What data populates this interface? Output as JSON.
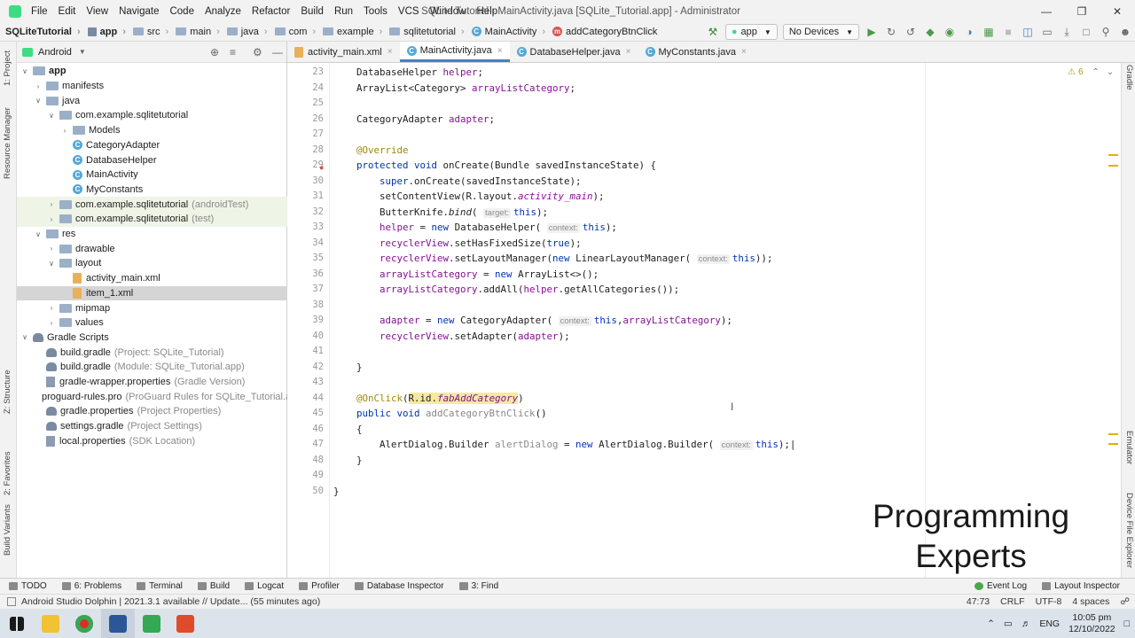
{
  "window": {
    "title": "SQLite Tutorial - MainActivity.java [SQLite_Tutorial.app] - Administrator",
    "menu": [
      "File",
      "Edit",
      "View",
      "Navigate",
      "Code",
      "Analyze",
      "Refactor",
      "Build",
      "Run",
      "Tools",
      "VCS",
      "Window",
      "Help"
    ]
  },
  "breadcrumb": [
    "SQLiteTutorial",
    "app",
    "src",
    "main",
    "java",
    "com",
    "example",
    "sqlitetutorial",
    "MainActivity",
    "addCategoryBtnClick"
  ],
  "toolbar": {
    "run_config": "app",
    "device": "No Devices"
  },
  "left_strip": [
    "1: Project",
    "Resource Manager",
    "Z: Structure",
    "2: Favorites",
    "Build Variants"
  ],
  "right_strip": [
    "Gradle",
    "Emulator",
    "Device File Explorer"
  ],
  "project": {
    "view": "Android",
    "tree": [
      {
        "label": "app",
        "depth": 0,
        "icon": "folder",
        "expanded": true,
        "bold": true
      },
      {
        "label": "manifests",
        "depth": 1,
        "icon": "folder",
        "expanded": false
      },
      {
        "label": "java",
        "depth": 1,
        "icon": "folder",
        "expanded": true
      },
      {
        "label": "com.example.sqlitetutorial",
        "depth": 2,
        "icon": "folder",
        "expanded": true
      },
      {
        "label": "Models",
        "depth": 3,
        "icon": "folder",
        "expanded": false
      },
      {
        "label": "CategoryAdapter",
        "depth": 3,
        "icon": "class"
      },
      {
        "label": "DatabaseHelper",
        "depth": 3,
        "icon": "class"
      },
      {
        "label": "MainActivity",
        "depth": 3,
        "icon": "class"
      },
      {
        "label": "MyConstants",
        "depth": 3,
        "icon": "class"
      },
      {
        "label": "com.example.sqlitetutorial",
        "hint": "(androidTest)",
        "depth": 2,
        "icon": "folder",
        "expanded": false,
        "green": true
      },
      {
        "label": "com.example.sqlitetutorial",
        "hint": "(test)",
        "depth": 2,
        "icon": "folder",
        "expanded": false,
        "green": true
      },
      {
        "label": "res",
        "depth": 1,
        "icon": "folder",
        "expanded": true
      },
      {
        "label": "drawable",
        "depth": 2,
        "icon": "folder",
        "expanded": false
      },
      {
        "label": "layout",
        "depth": 2,
        "icon": "folder",
        "expanded": true
      },
      {
        "label": "activity_main.xml",
        "depth": 3,
        "icon": "xml"
      },
      {
        "label": "item_1.xml",
        "depth": 3,
        "icon": "xml",
        "selected": true
      },
      {
        "label": "mipmap",
        "depth": 2,
        "icon": "folder",
        "expanded": false
      },
      {
        "label": "values",
        "depth": 2,
        "icon": "folder",
        "expanded": false
      },
      {
        "label": "Gradle Scripts",
        "depth": 0,
        "icon": "gradle",
        "expanded": true
      },
      {
        "label": "build.gradle",
        "hint": "(Project: SQLite_Tutorial)",
        "depth": 1,
        "icon": "gradle"
      },
      {
        "label": "build.gradle",
        "hint": "(Module: SQLite_Tutorial.app)",
        "depth": 1,
        "icon": "gradle"
      },
      {
        "label": "gradle-wrapper.properties",
        "hint": "(Gradle Version)",
        "depth": 1,
        "icon": "prop"
      },
      {
        "label": "proguard-rules.pro",
        "hint": "(ProGuard Rules for SQLite_Tutorial.ap",
        "depth": 1,
        "icon": "prop"
      },
      {
        "label": "gradle.properties",
        "hint": "(Project Properties)",
        "depth": 1,
        "icon": "gradle"
      },
      {
        "label": "settings.gradle",
        "hint": "(Project Settings)",
        "depth": 1,
        "icon": "gradle"
      },
      {
        "label": "local.properties",
        "hint": "(SDK Location)",
        "depth": 1,
        "icon": "prop"
      }
    ]
  },
  "tabs": [
    {
      "label": "activity_main.xml",
      "icon": "xml"
    },
    {
      "label": "MainActivity.java",
      "icon": "class",
      "active": true
    },
    {
      "label": "DatabaseHelper.java",
      "icon": "class"
    },
    {
      "label": "MyConstants.java",
      "icon": "class"
    }
  ],
  "editor": {
    "warning_count": "6",
    "lines": [
      {
        "n": "23",
        "html": "    DatabaseHelper <span class='fld'>helper</span>;"
      },
      {
        "n": "24",
        "html": "    ArrayList&lt;Category&gt; <span class='fld'>arrayListCategory</span>;"
      },
      {
        "n": "25",
        "html": ""
      },
      {
        "n": "26",
        "html": "    CategoryAdapter <span class='fld'>adapter</span>;"
      },
      {
        "n": "27",
        "html": ""
      },
      {
        "n": "28",
        "html": "    <span class='ann'>@Override</span>"
      },
      {
        "n": "29",
        "html": "    <span class='kw'>protected void</span> onCreate(Bundle savedInstanceState) {"
      },
      {
        "n": "30",
        "html": "        <span class='kw'>super</span>.onCreate(savedInstanceState);"
      },
      {
        "n": "31",
        "html": "        setContentView(R.layout.<span class='fieldit'>activity_main</span>);"
      },
      {
        "n": "32",
        "html": "        ButterKnife.<span class='it'>bind</span>( <span class='ph'>target:</span><span class='kw'>this</span>);"
      },
      {
        "n": "33",
        "html": "        <span class='fld'>helper</span> = <span class='kw'>new</span> DatabaseHelper( <span class='ph'>context:</span><span class='kw'>this</span>);"
      },
      {
        "n": "34",
        "html": "        <span class='fld'>recyclerView</span>.setHasFixedSize(<span class='kw'>true</span>);"
      },
      {
        "n": "35",
        "html": "        <span class='fld'>recyclerView</span>.setLayoutManager(<span class='kw'>new</span> LinearLayoutManager( <span class='ph'>context:</span><span class='kw'>this</span>));"
      },
      {
        "n": "36",
        "html": "        <span class='fld'>arrayListCategory</span> = <span class='kw'>new</span> ArrayList&lt;&gt;();"
      },
      {
        "n": "37",
        "html": "        <span class='fld'>arrayListCategory</span>.addAll(<span class='fld'>helper</span>.getAllCategories());"
      },
      {
        "n": "38",
        "html": ""
      },
      {
        "n": "39",
        "html": "        <span class='fld'>adapter</span> = <span class='kw'>new</span> CategoryAdapter( <span class='ph'>context:</span><span class='kw'>this</span>,<span class='fld'>arrayListCategory</span>);"
      },
      {
        "n": "40",
        "html": "        <span class='fld'>recyclerView</span>.setAdapter(<span class='fld'>adapter</span>);"
      },
      {
        "n": "41",
        "html": ""
      },
      {
        "n": "42",
        "html": "    }"
      },
      {
        "n": "43",
        "html": ""
      },
      {
        "n": "44",
        "html": "    <span class='ann'>@OnClick</span>(<span class='hl'>R.id.<span class='fieldit'>fabAddCategory</span></span>)"
      },
      {
        "n": "45",
        "html": "    <span class='kw'>public void</span> <span style='color:#888'>addCategoryBtnClick</span>()"
      },
      {
        "n": "46",
        "html": "    {"
      },
      {
        "n": "47",
        "html": "        AlertDialog.Builder <span style='color:#8c8c8c'>alertDialog</span> = <span class='kw'>new</span> AlertDialog.Builder( <span class='ph'>context:</span><span class='kw'>this</span>);|"
      },
      {
        "n": "48",
        "html": "    }"
      },
      {
        "n": "49",
        "html": ""
      },
      {
        "n": "50",
        "html": "}"
      }
    ]
  },
  "watermark": [
    "Programming",
    "Experts"
  ],
  "bottom_tools": [
    "TODO",
    "6: Problems",
    "Terminal",
    "Build",
    "Logcat",
    "Profiler",
    "Database Inspector",
    "3: Find",
    "Event Log",
    "Layout Inspector"
  ],
  "status": {
    "message": "Android Studio Dolphin | 2021.3.1 available // Update... (55 minutes ago)",
    "position": "47:73",
    "line_sep": "CRLF",
    "encoding": "UTF-8",
    "indent": "4 spaces"
  },
  "taskbar": {
    "lang": "ENG",
    "time": "10:05 pm",
    "date": "12/10/2022"
  }
}
